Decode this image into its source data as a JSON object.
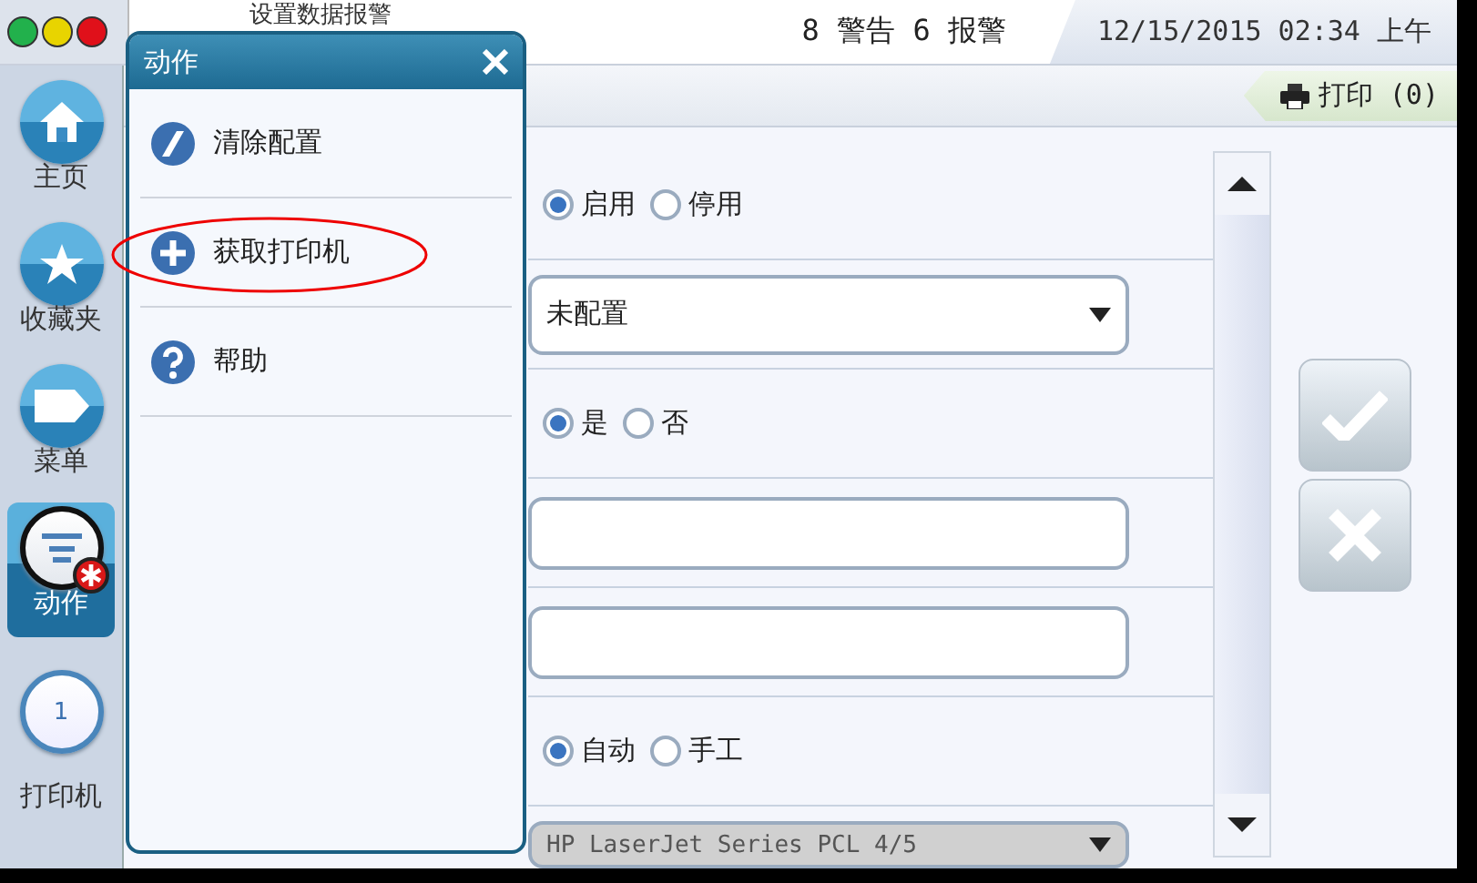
{
  "window": {
    "lights": [
      {
        "color": "#22b14c"
      },
      {
        "color": "#e8d400"
      },
      {
        "color": "#e0101a"
      }
    ]
  },
  "header": {
    "title": "设置数据报警",
    "alerts": "8 警告 6 报警",
    "datetime": "12/15/2015 02:34 上午"
  },
  "print_tab": {
    "label": "打印 (0)"
  },
  "sidebar": {
    "items": [
      {
        "kind": "home",
        "label": "主页",
        "selected": false
      },
      {
        "kind": "star",
        "label": "收藏夹",
        "selected": false
      },
      {
        "kind": "tag",
        "label": "菜单",
        "selected": false
      },
      {
        "kind": "actions",
        "label": "动作",
        "selected": true
      },
      {
        "kind": "counter",
        "label": "打印机",
        "count": "1",
        "selected": false
      }
    ]
  },
  "form": {
    "rows": [
      {
        "kind": "radio",
        "options": [
          {
            "label": "启用",
            "selected": true
          },
          {
            "label": "停用",
            "selected": false
          }
        ]
      },
      {
        "kind": "select",
        "value": "未配置",
        "disabled": false
      },
      {
        "kind": "radio",
        "options": [
          {
            "label": "是",
            "selected": true
          },
          {
            "label": "否",
            "selected": false
          }
        ]
      },
      {
        "kind": "text"
      },
      {
        "kind": "text"
      },
      {
        "kind": "radio",
        "options": [
          {
            "label": "自动",
            "selected": true
          },
          {
            "label": "手工",
            "selected": false
          }
        ]
      },
      {
        "kind": "select",
        "value": "HP LaserJet Series PCL 4/5",
        "disabled": true
      }
    ]
  },
  "buttons": [
    {
      "kind": "ok"
    },
    {
      "kind": "cancel"
    }
  ],
  "popup": {
    "title": "动作",
    "items": [
      {
        "kind": "eraser",
        "label": "清除配置",
        "circled": false
      },
      {
        "kind": "plus",
        "label": "获取打印机",
        "circled": true
      },
      {
        "kind": "help",
        "label": "帮助",
        "circled": false
      }
    ]
  }
}
